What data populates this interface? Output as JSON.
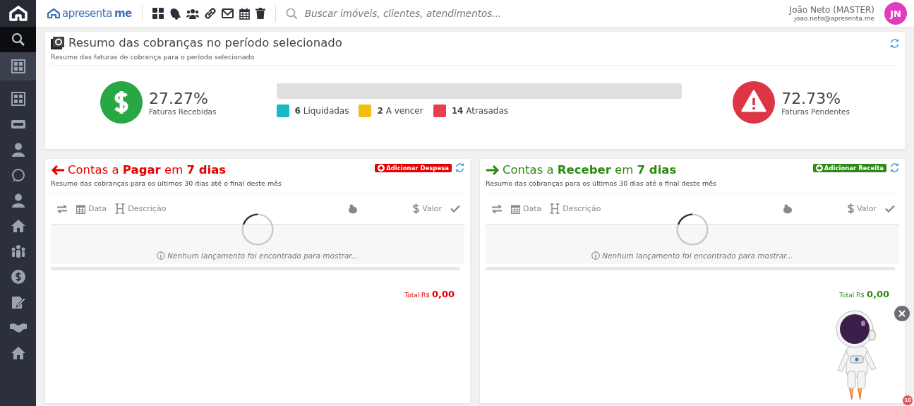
{
  "brand": {
    "name": "apresenta",
    "suffix": "me"
  },
  "sidebar": {
    "items": [
      {
        "kind": "search",
        "selected": false
      },
      {
        "kind": "grid",
        "selected": true
      },
      {
        "kind": "grid",
        "selected": false
      },
      {
        "kind": "new",
        "selected": false
      },
      {
        "kind": "user",
        "selected": false
      },
      {
        "kind": "chat",
        "selected": false
      },
      {
        "kind": "user",
        "selected": false
      },
      {
        "kind": "home",
        "selected": false
      },
      {
        "kind": "people",
        "selected": false
      },
      {
        "kind": "dollar",
        "selected": false
      },
      {
        "kind": "sign",
        "selected": false
      },
      {
        "kind": "hands",
        "selected": false
      },
      {
        "kind": "home",
        "selected": false
      }
    ]
  },
  "toolbar": [
    {
      "kind": "grid"
    },
    {
      "kind": "bell"
    },
    {
      "kind": "people"
    },
    {
      "kind": "link"
    },
    {
      "kind": "mail"
    },
    {
      "kind": "calendar"
    },
    {
      "kind": "trash"
    }
  ],
  "search": {
    "placeholder": "Buscar imóveis, clientes, atendimentos..."
  },
  "user": {
    "name": "João Neto (MASTER)",
    "email": "joao.neto@apresenta.me",
    "initials": "JN"
  },
  "summary": {
    "title": "Resumo das cobranças no período selecionado",
    "subtitle": "Resumo das faturas de cobrança para o período selecionado",
    "received": {
      "value": "27.27%",
      "label": "Faturas Recebidas"
    },
    "pending": {
      "value": "72.73%",
      "label": "Faturas Pendentes"
    },
    "progress": {
      "level": 0
    },
    "segments": [
      {
        "count": "6",
        "label": "Liquidadas",
        "color": "#1ab7c7"
      },
      {
        "count": "2",
        "label": "A vencer",
        "color": "#f0bd10"
      },
      {
        "count": "14",
        "label": "Atrasadas",
        "color": "#e83e50"
      }
    ]
  },
  "panels": [
    {
      "kind": "pay",
      "title_pre": "Contas a ",
      "title_bold": "Pagar",
      "title_mid": " em ",
      "title_days": "7 dias",
      "button": "Adicionar Despesa",
      "subtitle": "Resumo das cobranças para os últimos 30 dias até o final deste mês",
      "columns": [
        "Data",
        "Descrição",
        "Valor"
      ],
      "empty": "Nenhum lançamento foi encontrado para mostrar...",
      "total_label": "Total R$",
      "total": "0,00"
    },
    {
      "kind": "receive",
      "title_pre": "Contas a ",
      "title_bold": "Receber",
      "title_mid": " em ",
      "title_days": "7 dias",
      "button": "Adicionar Receita",
      "subtitle": "Resumo das cobranças para os últimos 30 dias até o final deste mês",
      "columns": [
        "Data",
        "Descrição",
        "Valor"
      ],
      "empty": "Nenhum lançamento foi encontrado para mostrar...",
      "total_label": "Total R$",
      "total": "0,00"
    }
  ],
  "assistant": {
    "badge": "10"
  }
}
